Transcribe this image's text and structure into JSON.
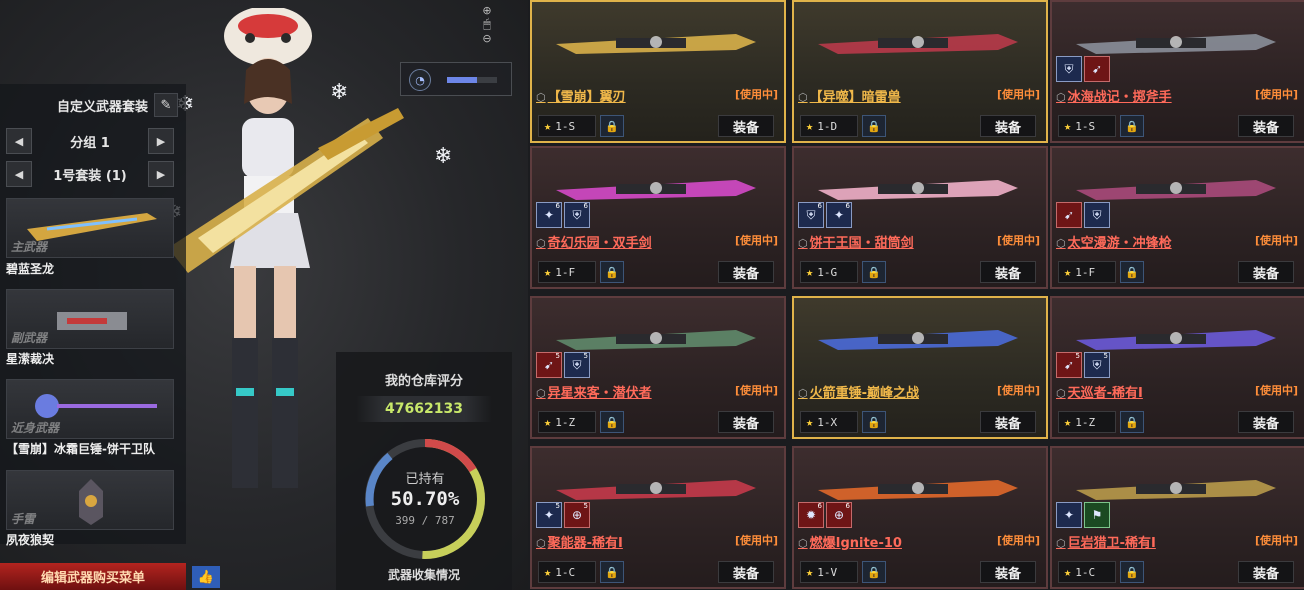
{
  "left_panel": {
    "title": "自定义武器套装",
    "edit_icon": "pencil-icon",
    "group_selector": {
      "value": "分组 1"
    },
    "suit_selector": {
      "value": "1号套装 (1)"
    },
    "slots": [
      {
        "tag": "主武器",
        "name": "碧蓝圣龙"
      },
      {
        "tag": "副武器",
        "name": "星潆裁决"
      },
      {
        "tag": "近身武器",
        "name": "【雪崩】冰霜巨锤-饼干卫队"
      },
      {
        "tag": "手雷",
        "name": "夙夜狼契"
      }
    ],
    "buy_menu_label": "编辑武器购买菜单",
    "like_icon": "thumbs-up-icon"
  },
  "rating": {
    "title": "我的仓库评分",
    "score": "47662133",
    "owned_label": "已持有",
    "percent": "50.70%",
    "count": "399 / 787",
    "owned_fraction": 0.507,
    "footer": "武器收集情况"
  },
  "weapons": [
    {
      "name": "【雪崩】翼刃",
      "status": "[使用中]",
      "rank": "1-S",
      "equip": "装备",
      "selected": true,
      "badges": []
    },
    {
      "name": "【异噬】暗雷兽",
      "status": "[使用中]",
      "rank": "1-D",
      "equip": "装备",
      "selected": true,
      "badges": []
    },
    {
      "name": "冰海战记・掷斧手",
      "status": "[使用中]",
      "rank": "1-S",
      "equip": "装备",
      "selected": false,
      "badges": [
        {
          "icon": "shield-icon",
          "color": "blue"
        },
        {
          "icon": "rocket-icon",
          "color": "red"
        }
      ]
    },
    {
      "name": "奇幻乐园・双手剑",
      "status": "[使用中]",
      "rank": "1-F",
      "equip": "装备",
      "selected": false,
      "badges": [
        {
          "icon": "sparkle-icon",
          "color": "blue",
          "level": "6"
        },
        {
          "icon": "shield-icon",
          "color": "blue",
          "level": "6"
        }
      ]
    },
    {
      "name": "饼干王国・甜筒剑",
      "status": "[使用中]",
      "rank": "1-G",
      "equip": "装备",
      "selected": false,
      "badges": [
        {
          "icon": "shield-icon",
          "color": "blue",
          "level": "6"
        },
        {
          "icon": "sparkle-icon",
          "color": "blue",
          "level": "6"
        }
      ]
    },
    {
      "name": "太空漫游・冲锋枪",
      "status": "[使用中]",
      "rank": "1-F",
      "equip": "装备",
      "selected": false,
      "badges": [
        {
          "icon": "rocket-icon",
          "color": "red"
        },
        {
          "icon": "shield-icon",
          "color": "blue"
        }
      ]
    },
    {
      "name": "异星来客・潜伏者",
      "status": "[使用中]",
      "rank": "1-Z",
      "equip": "装备",
      "selected": false,
      "badges": [
        {
          "icon": "rocket-icon",
          "color": "red",
          "level": "5"
        },
        {
          "icon": "shield-icon",
          "color": "blue",
          "level": "5"
        }
      ]
    },
    {
      "name": "火箭重锤-巅峰之战",
      "status": "[使用中]",
      "rank": "1-X",
      "equip": "装备",
      "selected": true,
      "badges": []
    },
    {
      "name": "天巡者-稀有Ⅰ",
      "status": "[使用中]",
      "rank": "1-Z",
      "equip": "装备",
      "selected": false,
      "badges": [
        {
          "icon": "rocket-icon",
          "color": "red",
          "level": "5"
        },
        {
          "icon": "shield-icon",
          "color": "blue",
          "level": "5"
        }
      ]
    },
    {
      "name": "聚能器-稀有Ⅰ",
      "status": "[使用中]",
      "rank": "1-C",
      "equip": "装备",
      "selected": false,
      "badges": [
        {
          "icon": "sparkle-icon",
          "color": "blue",
          "level": "5"
        },
        {
          "icon": "crosshair-icon",
          "color": "red",
          "level": "5"
        }
      ]
    },
    {
      "name": "燃爆Ignite-10",
      "status": "[使用中]",
      "rank": "1-V",
      "equip": "装备",
      "selected": false,
      "badges": [
        {
          "icon": "burst-icon",
          "color": "red",
          "level": "6"
        },
        {
          "icon": "crosshair-icon",
          "color": "red",
          "level": "6"
        }
      ]
    },
    {
      "name": "巨岩猎卫-稀有Ⅰ",
      "status": "[使用中]",
      "rank": "1-C",
      "equip": "装备",
      "selected": false,
      "badges": [
        {
          "icon": "sparkle-icon",
          "color": "blue"
        },
        {
          "icon": "boot-icon",
          "color": "green"
        }
      ]
    }
  ]
}
